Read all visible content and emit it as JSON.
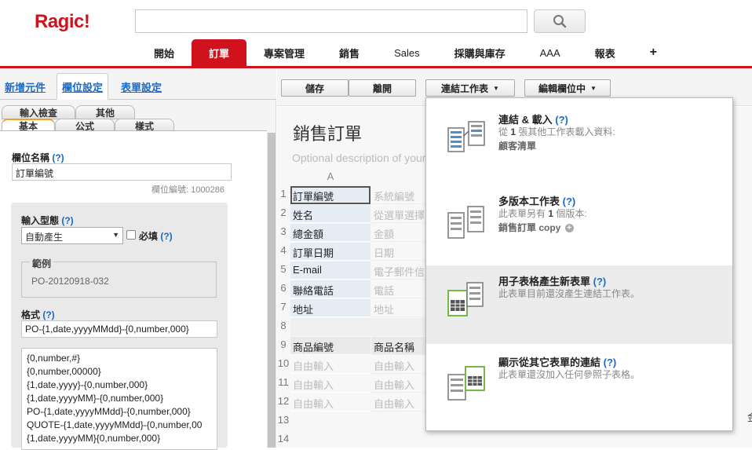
{
  "app": {
    "logo": "Ragic!"
  },
  "search": {
    "placeholder": "",
    "value": ""
  },
  "nav": {
    "tabs": [
      {
        "label": "開始"
      },
      {
        "label": "訂單"
      },
      {
        "label": "專案管理"
      },
      {
        "label": "銷售"
      },
      {
        "label": "Sales"
      },
      {
        "label": "採購與庫存"
      },
      {
        "label": "AAA"
      },
      {
        "label": "報表"
      },
      {
        "label": "+"
      }
    ],
    "active_index": 1,
    "accent_color": "#d0121c"
  },
  "left_panel": {
    "tabs": [
      {
        "label": "新增元件"
      },
      {
        "label": "欄位設定"
      },
      {
        "label": "表單設定"
      }
    ],
    "subtabs_row1": [
      {
        "label": "輸入檢查"
      },
      {
        "label": "其他"
      }
    ],
    "subtabs_row2": [
      {
        "label": "基本"
      },
      {
        "label": "公式"
      },
      {
        "label": "樣式"
      }
    ],
    "field_name": {
      "label": "欄位名稱",
      "help": "(?)",
      "value": "訂單編號",
      "id_caption": "欄位編號: 1000286"
    },
    "input_type": {
      "label": "輸入型態",
      "help": "(?)",
      "value": "自動產生",
      "required_label": "必填",
      "required_help": "(?)"
    },
    "example": {
      "legend": "範例",
      "value": "PO-20120918-032"
    },
    "format": {
      "label": "格式",
      "help": "(?)",
      "value": "PO-{1,date,yyyyMMdd}-{0,number,000}",
      "options": [
        "{0,number,#}",
        "{0,number,00000}",
        "{1,date,yyyy}-{0,number,000}",
        "{1,date,yyyyMM}-{0,number,000}",
        "PO-{1,date,yyyyMMdd}-{0,number,000}",
        "QUOTE-{1,date,yyyyMMdd}-{0,number,00",
        "{1,date,yyyyMM}{0,number,000}"
      ]
    }
  },
  "toolbar": {
    "save": "儲存",
    "leave": "離開",
    "link_sheet": "連結工作表",
    "edit_field": "編輯欄位中"
  },
  "sheet": {
    "title": "銷售訂單",
    "description": "Optional description of your",
    "column_header": "A",
    "rows": [
      {
        "num": "1",
        "a": "訂單編號",
        "b": "系統編號"
      },
      {
        "num": "2",
        "a": "姓名",
        "b": "從選單選擇"
      },
      {
        "num": "3",
        "a": "總金額",
        "b": "金額"
      },
      {
        "num": "4",
        "a": "訂單日期",
        "b": "日期"
      },
      {
        "num": "5",
        "a": "E-mail",
        "b": "電子郵件信"
      },
      {
        "num": "6",
        "a": "聯絡電話",
        "b": "電話"
      },
      {
        "num": "7",
        "a": "地址",
        "b": "地址"
      },
      {
        "num": "8",
        "a": "",
        "b": ""
      },
      {
        "num": "9",
        "a": "商品編號",
        "b": "商品名稱"
      },
      {
        "num": "10",
        "a": "自由輸入",
        "b": "自由輸入"
      },
      {
        "num": "11",
        "a": "自由輸入",
        "b": "自由輸入"
      },
      {
        "num": "12",
        "a": "自由輸入",
        "b": "自由輸入"
      },
      {
        "num": "13",
        "a": "",
        "b": ""
      },
      {
        "num": "14",
        "a": "",
        "b": ""
      }
    ],
    "edge_text": "金"
  },
  "dropdown": {
    "items": [
      {
        "title": "連結 & 載入",
        "help": "(?)",
        "line1_pre": "從 ",
        "line1_bold": "1",
        "line1_post": " 張其他工作表載入資料:",
        "sub": "顧客清單"
      },
      {
        "title": "多版本工作表",
        "help": "(?)",
        "line1_pre": "此表單另有 ",
        "line1_bold": "1",
        "line1_post": " 個版本:",
        "sub": "銷售訂單 copy"
      },
      {
        "title": "用子表格產生新表單",
        "help": "(?)",
        "line1": "此表單目前還沒產生連結工作表。"
      },
      {
        "title": "顯示從其它表單的連結",
        "help": "(?)",
        "line1": "此表單還沒加入任何參照子表格。"
      }
    ]
  }
}
